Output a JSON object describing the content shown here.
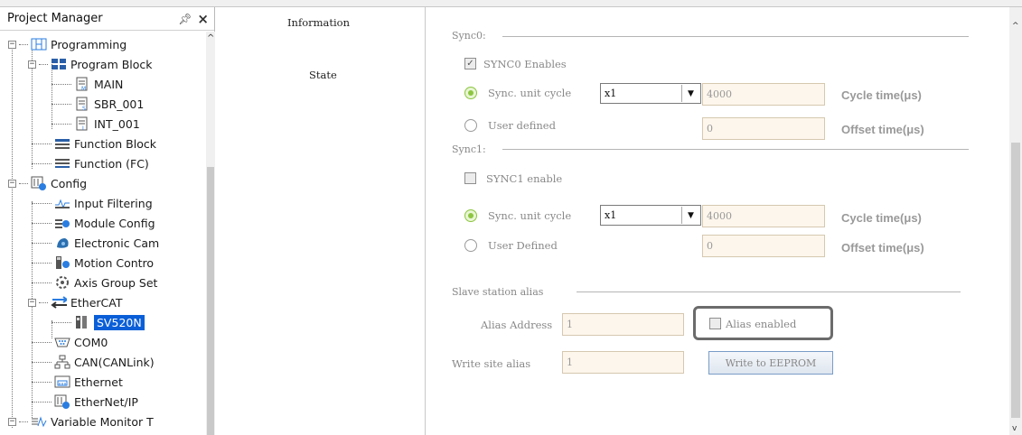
{
  "project_manager": {
    "title": "Project Manager",
    "pin_glyph": "ᵖ",
    "close_glyph": "×",
    "tree": [
      {
        "label": "Programming",
        "icon": "ladder-icon"
      },
      {
        "label": "Program Block",
        "icon": "program-block-icon"
      },
      {
        "label": "MAIN",
        "icon": "main-program-icon"
      },
      {
        "label": "SBR_001",
        "icon": "subroutine-icon"
      },
      {
        "label": "INT_001",
        "icon": "interrupt-icon"
      },
      {
        "label": "Function Block",
        "icon": "function-block-icon"
      },
      {
        "label": "Function (FC)",
        "icon": "function-icon"
      },
      {
        "label": "Config",
        "icon": "config-icon"
      },
      {
        "label": "Input Filtering",
        "icon": "input-filtering-icon"
      },
      {
        "label": "Module Config",
        "icon": "module-config-icon"
      },
      {
        "label": "Electronic Cam",
        "icon": "electronic-cam-icon"
      },
      {
        "label": "Motion Contro",
        "icon": "motion-control-icon"
      },
      {
        "label": "Axis Group Set",
        "icon": "axis-group-icon"
      },
      {
        "label": "EtherCAT",
        "icon": "ethercat-icon"
      },
      {
        "label": "SV520N",
        "icon": "servo-device-icon"
      },
      {
        "label": "COM0",
        "icon": "com-port-icon"
      },
      {
        "label": "CAN(CANLink)",
        "icon": "can-network-icon"
      },
      {
        "label": "Ethernet",
        "icon": "ethernet-icon"
      },
      {
        "label": "EtherNet/IP",
        "icon": "ethernet-ip-icon"
      },
      {
        "label": "Variable Monitor T",
        "icon": "variable-monitor-icon"
      }
    ]
  },
  "nav": {
    "information": "Information",
    "state": "State"
  },
  "sync0": {
    "section_label": "Sync0:",
    "enable_label": "SYNC0 Enables",
    "enable_checked": true,
    "unit_cycle_label": "Sync. unit cycle",
    "unit_cycle_selected": true,
    "multiplier": "x1",
    "cycle_time_value": "4000",
    "cycle_time_label": "Cycle time(μs)",
    "user_defined_label": "User defined",
    "offset_value": "0",
    "offset_label": "Offset time(μs)"
  },
  "sync1": {
    "section_label": "Sync1:",
    "enable_label": "SYNC1 enable",
    "enable_checked": false,
    "unit_cycle_label": "Sync. unit cycle",
    "multiplier": "x1",
    "cycle_time_value": "4000",
    "cycle_time_label": "Cycle time(μs)",
    "user_defined_label": "User Defined",
    "offset_value": "0",
    "offset_label": "Offset time(μs)"
  },
  "alias": {
    "section_label": "Slave station alias",
    "address_label": "Alias Address",
    "address_value": "1",
    "enabled_label": "Alias enabled",
    "write_label": "Write site alias",
    "write_value": "1",
    "write_button": "Write to EEPROM"
  },
  "colors": {
    "selection": "#0a5fd8",
    "radio_on": "#8cc63f",
    "field_bg": "#fdf6ec",
    "highlight_border": "#6b6b6b"
  }
}
